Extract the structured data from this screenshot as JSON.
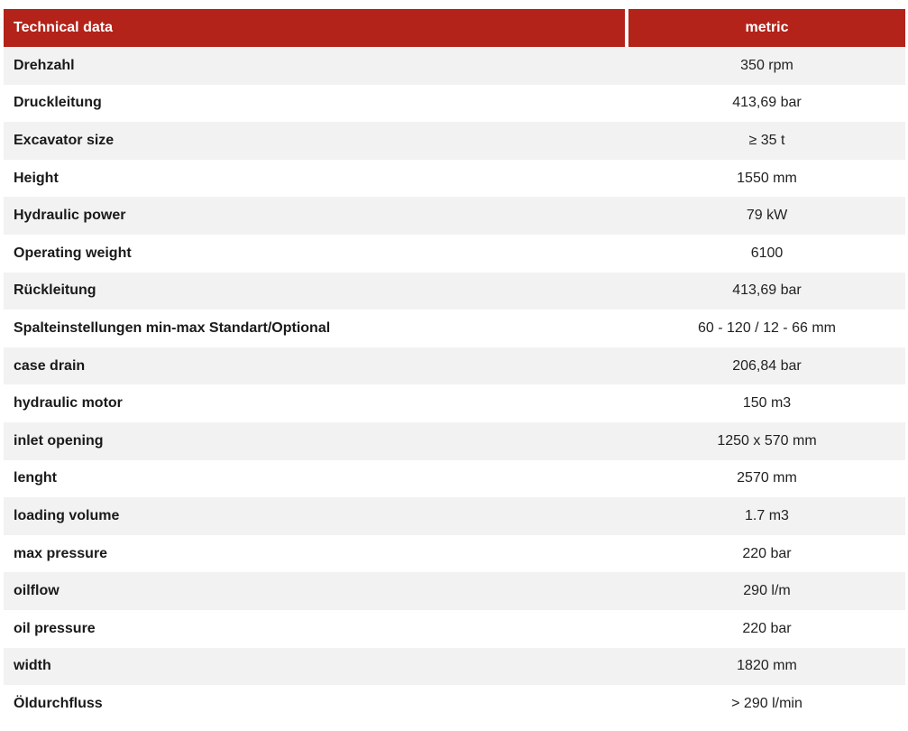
{
  "header": {
    "left": "Technical data",
    "right": "metric"
  },
  "colors": {
    "header_bg": "#b32319",
    "row_alt_bg": "#f2f2f2"
  },
  "rows": [
    {
      "label": "Drehzahl",
      "value": "350 rpm"
    },
    {
      "label": "Druckleitung",
      "value": "413,69 bar"
    },
    {
      "label": "Excavator size",
      "value": "≥ 35 t"
    },
    {
      "label": "Height",
      "value": "1550 mm"
    },
    {
      "label": "Hydraulic power",
      "value": "79 kW"
    },
    {
      "label": "Operating weight",
      "value": "6100"
    },
    {
      "label": "Rückleitung",
      "value": "413,69 bar"
    },
    {
      "label": "Spalteinstellungen min-max Standart/Optional",
      "value": "60 - 120 / 12 - 66 mm"
    },
    {
      "label": "case drain",
      "value": "206,84 bar"
    },
    {
      "label": "hydraulic motor",
      "value": "150 m3"
    },
    {
      "label": "inlet opening",
      "value": "1250 x 570 mm"
    },
    {
      "label": "lenght",
      "value": "2570 mm"
    },
    {
      "label": "loading volume",
      "value": "1.7 m3"
    },
    {
      "label": "max pressure",
      "value": "220 bar"
    },
    {
      "label": "oilflow",
      "value": "290 l/m"
    },
    {
      "label": "oil pressure",
      "value": "220 bar"
    },
    {
      "label": "width",
      "value": "1820 mm"
    },
    {
      "label": "Öldurchfluss",
      "value": "> 290 l/min"
    }
  ]
}
